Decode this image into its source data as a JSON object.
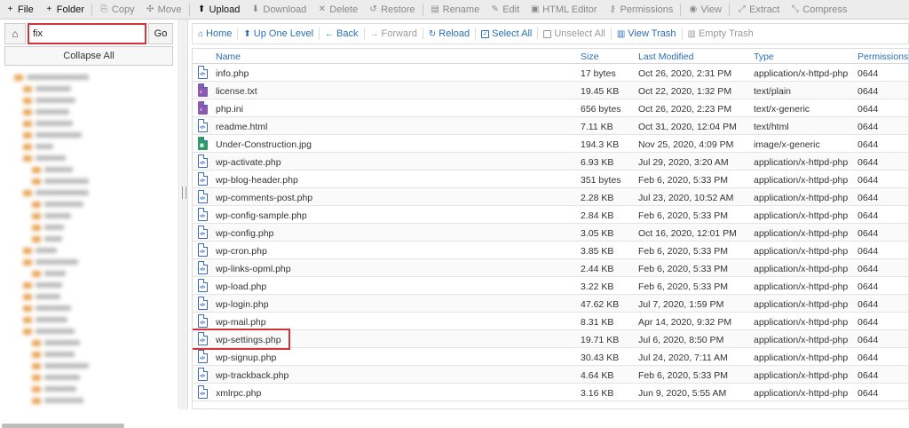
{
  "toolbar": {
    "items": [
      {
        "label": "File",
        "icon": "plus-icon",
        "glyph": "+",
        "enabled": true
      },
      {
        "label": "Folder",
        "icon": "plus-icon",
        "glyph": "+",
        "enabled": true
      },
      {
        "label": "Copy",
        "icon": "copy-icon",
        "glyph": "⎘",
        "enabled": false
      },
      {
        "label": "Move",
        "icon": "move-icon",
        "glyph": "✣",
        "enabled": false
      },
      {
        "label": "Upload",
        "icon": "upload-icon",
        "glyph": "⬆",
        "enabled": true
      },
      {
        "label": "Download",
        "icon": "download-icon",
        "glyph": "⬇",
        "enabled": false
      },
      {
        "label": "Delete",
        "icon": "delete-icon",
        "glyph": "✕",
        "enabled": false
      },
      {
        "label": "Restore",
        "icon": "restore-icon",
        "glyph": "↺",
        "enabled": false
      },
      {
        "label": "Rename",
        "icon": "rename-icon",
        "glyph": "▤",
        "enabled": false
      },
      {
        "label": "Edit",
        "icon": "edit-icon",
        "glyph": "✎",
        "enabled": false
      },
      {
        "label": "HTML Editor",
        "icon": "html-editor-icon",
        "glyph": "▣",
        "enabled": false
      },
      {
        "label": "Permissions",
        "icon": "key-icon",
        "glyph": "⚷",
        "enabled": false
      },
      {
        "label": "View",
        "icon": "eye-icon",
        "glyph": "◉",
        "enabled": false
      },
      {
        "label": "Extract",
        "icon": "extract-icon",
        "glyph": "⤢",
        "enabled": false
      },
      {
        "label": "Compress",
        "icon": "compress-icon",
        "glyph": "⤡",
        "enabled": false
      }
    ]
  },
  "sidebar": {
    "search_value": "fix",
    "go_label": "Go",
    "collapse_label": "Collapse All"
  },
  "nav": {
    "home": "Home",
    "up": "Up One Level",
    "back": "Back",
    "forward": "Forward",
    "reload": "Reload",
    "select_all": "Select All",
    "unselect_all": "Unselect All",
    "view_trash": "View Trash",
    "empty_trash": "Empty Trash"
  },
  "columns": {
    "name": "Name",
    "size": "Size",
    "modified": "Last Modified",
    "type": "Type",
    "permissions": "Permissions"
  },
  "files": [
    {
      "name": "info.php",
      "size": "17 bytes",
      "modified": "Oct 26, 2020, 2:31 PM",
      "type": "application/x-httpd-php",
      "perms": "0644",
      "kind": "php"
    },
    {
      "name": "license.txt",
      "size": "19.45 KB",
      "modified": "Oct 22, 2020, 1:32 PM",
      "type": "text/plain",
      "perms": "0644",
      "kind": "txt"
    },
    {
      "name": "php.ini",
      "size": "656 bytes",
      "modified": "Oct 26, 2020, 2:23 PM",
      "type": "text/x-generic",
      "perms": "0644",
      "kind": "txt"
    },
    {
      "name": "readme.html",
      "size": "7.11 KB",
      "modified": "Oct 31, 2020, 12:04 PM",
      "type": "text/html",
      "perms": "0644",
      "kind": "php"
    },
    {
      "name": "Under-Construction.jpg",
      "size": "194.3 KB",
      "modified": "Nov 25, 2020, 4:09 PM",
      "type": "image/x-generic",
      "perms": "0644",
      "kind": "img"
    },
    {
      "name": "wp-activate.php",
      "size": "6.93 KB",
      "modified": "Jul 29, 2020, 3:20 AM",
      "type": "application/x-httpd-php",
      "perms": "0644",
      "kind": "php"
    },
    {
      "name": "wp-blog-header.php",
      "size": "351 bytes",
      "modified": "Feb 6, 2020, 5:33 PM",
      "type": "application/x-httpd-php",
      "perms": "0644",
      "kind": "php"
    },
    {
      "name": "wp-comments-post.php",
      "size": "2.28 KB",
      "modified": "Jul 23, 2020, 10:52 AM",
      "type": "application/x-httpd-php",
      "perms": "0644",
      "kind": "php"
    },
    {
      "name": "wp-config-sample.php",
      "size": "2.84 KB",
      "modified": "Feb 6, 2020, 5:33 PM",
      "type": "application/x-httpd-php",
      "perms": "0644",
      "kind": "php"
    },
    {
      "name": "wp-config.php",
      "size": "3.05 KB",
      "modified": "Oct 16, 2020, 12:01 PM",
      "type": "application/x-httpd-php",
      "perms": "0644",
      "kind": "php"
    },
    {
      "name": "wp-cron.php",
      "size": "3.85 KB",
      "modified": "Feb 6, 2020, 5:33 PM",
      "type": "application/x-httpd-php",
      "perms": "0644",
      "kind": "php"
    },
    {
      "name": "wp-links-opml.php",
      "size": "2.44 KB",
      "modified": "Feb 6, 2020, 5:33 PM",
      "type": "application/x-httpd-php",
      "perms": "0644",
      "kind": "php"
    },
    {
      "name": "wp-load.php",
      "size": "3.22 KB",
      "modified": "Feb 6, 2020, 5:33 PM",
      "type": "application/x-httpd-php",
      "perms": "0644",
      "kind": "php"
    },
    {
      "name": "wp-login.php",
      "size": "47.62 KB",
      "modified": "Jul 7, 2020, 1:59 PM",
      "type": "application/x-httpd-php",
      "perms": "0644",
      "kind": "php"
    },
    {
      "name": "wp-mail.php",
      "size": "8.31 KB",
      "modified": "Apr 14, 2020, 9:32 PM",
      "type": "application/x-httpd-php",
      "perms": "0644",
      "kind": "php"
    },
    {
      "name": "wp-settings.php",
      "size": "19.71 KB",
      "modified": "Jul 6, 2020, 8:50 PM",
      "type": "application/x-httpd-php",
      "perms": "0644",
      "kind": "php",
      "highlight": true
    },
    {
      "name": "wp-signup.php",
      "size": "30.43 KB",
      "modified": "Jul 24, 2020, 7:11 AM",
      "type": "application/x-httpd-php",
      "perms": "0644",
      "kind": "php"
    },
    {
      "name": "wp-trackback.php",
      "size": "4.64 KB",
      "modified": "Feb 6, 2020, 5:33 PM",
      "type": "application/x-httpd-php",
      "perms": "0644",
      "kind": "php"
    },
    {
      "name": "xmlrpc.php",
      "size": "3.16 KB",
      "modified": "Jun 9, 2020, 5:55 AM",
      "type": "application/x-httpd-php",
      "perms": "0644",
      "kind": "php"
    }
  ],
  "colors": {
    "accent": "#2a6db5",
    "highlight": "#d5333a",
    "folder": "#e9a75b"
  }
}
